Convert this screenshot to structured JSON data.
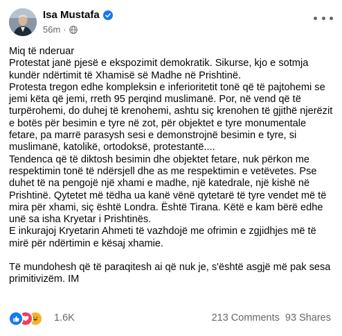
{
  "author": {
    "name": "Isa Mustafa",
    "time": "56m",
    "separator": "·"
  },
  "post": {
    "paragraphs": [
      "Miq të nderuar\nProtestat janë pjesë e ekspozimit demokratik. Sikurse, kjo e sotmja kundër ndërtimit të Xhamisë së Madhe në Prishtinë.\nProtesta tregon edhe kompleksin e inferioritetit tonë që të pajtohemi se jemi këta që jemi, rreth 95 perqind muslimanë. Por, në vend që të turpërohemi, do duhej të krenohemi, ashtu siç krenohen të gjithë njerëzit e botës për besimin e tyre në zot, për objektet e tyre monumentale fetare, pa marrë parasysh sesi e demonstrojnë besimin e tyre, si muslimanë, katolikë, ortodoksë, protestantë....\nTendenca që të diktosh besimin dhe objektet fetare, nuk përkon me respektimin tonë të ndërsjell dhe as me respektimin e vetëvetes. Pse duhet të na pengojë një xhami e madhe, një katedrale, një kishë në Prishtinë. Qytetet më tëdha ua kanë vënë qytetarë të tyre vendet më të mira për xhami, siç është Londra. Është Tirana.  Këtë e kam bërë edhe unë sa isha Kryetar i Prishtinës.\nE inkurajoj Kryetarin Ahmeti të vazhdojë me ofrimin e zgjidhjes më të mirë për ndërtimin e kësaj xhamie.",
      "Të mundohesh që të paraqitesh ai që nuk je, s'është asgjë më pak sesa primitivizëm. IM"
    ]
  },
  "engagement": {
    "reactions_count": "1.6K",
    "comments": "213 Comments",
    "shares": "93 Shares",
    "reaction_icons": [
      "like-icon",
      "love-icon",
      "haha-icon"
    ],
    "colors": {
      "like": "#1877f2",
      "love": "#f33e58",
      "haha": "#f7b125",
      "verified": "#1877f2"
    }
  }
}
